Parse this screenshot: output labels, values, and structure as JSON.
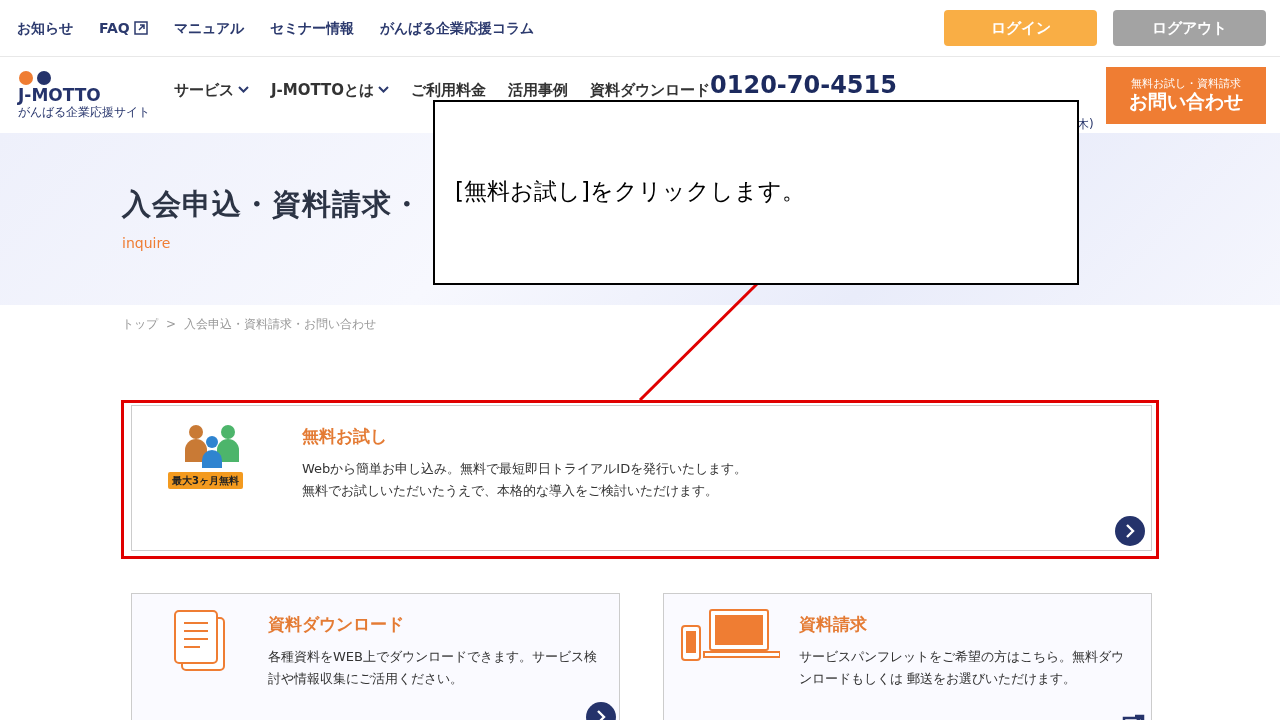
{
  "top_links": [
    {
      "label": "お知らせ",
      "external": false
    },
    {
      "label": "FAQ",
      "external": true
    },
    {
      "label": "マニュアル",
      "external": false
    },
    {
      "label": "セミナー情報",
      "external": false
    },
    {
      "label": "がんばる企業応援コラム",
      "external": false
    }
  ],
  "auth_buttons": [
    {
      "label": "ログイン",
      "kind": "login"
    },
    {
      "label": "ログアウト",
      "kind": "logout"
    }
  ],
  "logo": {
    "text": "J-MOTTO",
    "tagline": "がんばる企業応援サイト"
  },
  "nav": [
    {
      "label": "サービス",
      "dropdown": true
    },
    {
      "label": "J-MOTTOとは",
      "dropdown": true
    },
    {
      "label": "ご利用料金",
      "dropdown": false
    },
    {
      "label": "活用事例",
      "dropdown": false
    },
    {
      "label": "資料ダウンロード",
      "dropdown": false
    }
  ],
  "phone": {
    "number": "0120-70-4515",
    "hours_visible": "木)"
  },
  "contact_button": {
    "sub": "無料お試し・資料請求",
    "main": "お問い合わせ"
  },
  "hero": {
    "title": "入会申込・資料請求・",
    "subtitle": "inquire"
  },
  "breadcrumb": [
    "トップ",
    "入会申込・資料請求・お問い合わせ"
  ],
  "breadcrumb_separator": ">",
  "trial_card": {
    "title": "無料お試し",
    "badge": "最大3ヶ月無料",
    "lines": [
      "Webから簡単お申し込み。無料で最短即日トライアルIDを発行いたします。",
      "無料でお試しいただいたうえで、本格的な導入をご検討いただけます。"
    ]
  },
  "cards": [
    {
      "kind": "download",
      "title": "資料ダウンロード",
      "text": "各種資料をWEB上でダウンロードできます。サービス検討や情報収集にご活用ください。"
    },
    {
      "kind": "request",
      "title": "資料請求",
      "text": "サービスパンフレットをご希望の方はこちら。無料ダウンロードもしくは 郵送をお選びいただけます。"
    }
  ],
  "callout": {
    "text": "[無料お試し]をクリックします。"
  }
}
